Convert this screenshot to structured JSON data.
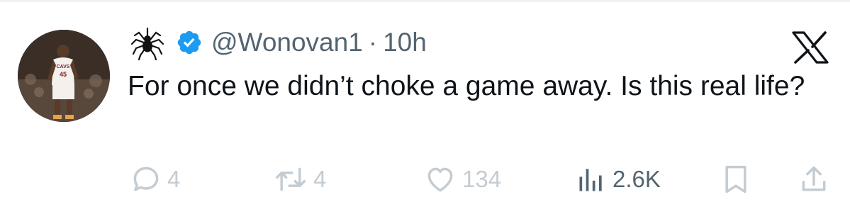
{
  "tweet": {
    "handle": "@Wonovan1",
    "separator": "·",
    "time": "10h",
    "text": "For once we didn’t choke a game away. Is this real life?",
    "avatar_jersey_number": "45",
    "avatar_jersey_text": "CAVS"
  },
  "actions": {
    "reply_count": "4",
    "retweet_count": "4",
    "like_count": "134",
    "views_count": "2.6K"
  },
  "icons": {
    "name_emoji": "spider-icon",
    "verified": "verified-badge-icon",
    "brand": "x-logo-icon",
    "reply": "reply-icon",
    "retweet": "retweet-icon",
    "like": "heart-icon",
    "views": "views-icon",
    "bookmark": "bookmark-icon",
    "share": "share-icon"
  },
  "colors": {
    "verified_blue": "#1d9bf0",
    "muted_text": "#536471",
    "faded_actions": "#c4ccd2",
    "text": "#0f1419"
  }
}
